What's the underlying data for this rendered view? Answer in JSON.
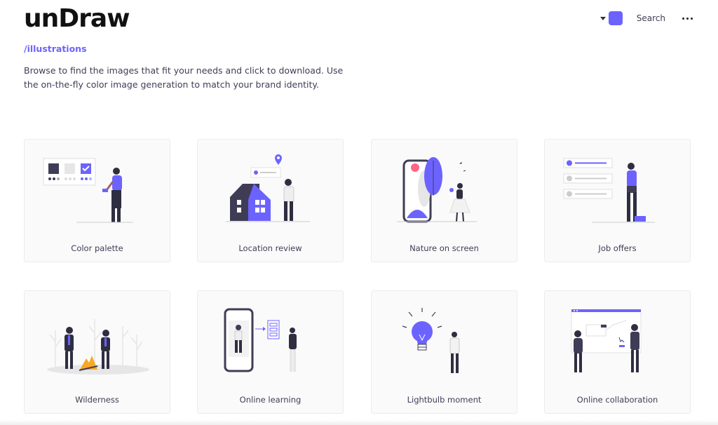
{
  "header": {
    "logo": "unDraw",
    "search_label": "Search",
    "accent_color": "#6c63ff",
    "icons": [
      "caret-down-icon",
      "color-swatch",
      "more-dots-icon"
    ]
  },
  "section": {
    "link": "/illustrations",
    "intro": "Browse to find the images that fit your needs and click to download. Use the on-the-fly color image generation to match your brand identity."
  },
  "cards": [
    {
      "label": "Color palette"
    },
    {
      "label": "Location review"
    },
    {
      "label": "Nature on screen"
    },
    {
      "label": "Job offers"
    },
    {
      "label": "Wilderness"
    },
    {
      "label": "Online learning"
    },
    {
      "label": "Lightbulb moment"
    },
    {
      "label": "Online collaboration"
    }
  ]
}
